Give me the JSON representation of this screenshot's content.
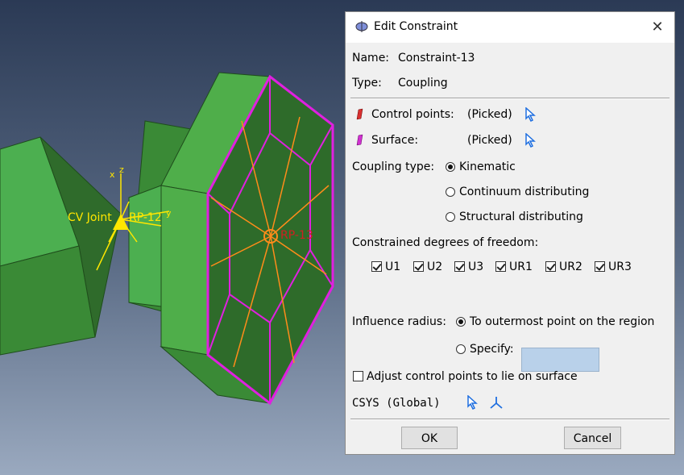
{
  "viewport": {
    "labels": {
      "cv_joint": "CV Joint",
      "rp12": "RP-12",
      "rp13": "RP-13",
      "axis_x": "x",
      "axis_z": "z",
      "axis_y": "y"
    },
    "colors": {
      "part_green": "#3f8f3a",
      "part_dark": "#2e6b2a",
      "surface_magenta": "#e020e0",
      "spoke_orange": "#ff8c1a",
      "marker_yellow": "#ffe600"
    }
  },
  "dialog": {
    "title": "Edit Constraint",
    "close_icon": "close-icon",
    "name_label": "Name:",
    "name_value": "Constraint-13",
    "type_label": "Type:",
    "type_value": "Coupling",
    "control_points_label": "Control points:",
    "control_points_value": "(Picked)",
    "surface_label": "Surface:",
    "surface_value": "(Picked)",
    "coupling_type_label": "Coupling type:",
    "coupling_options": [
      "Kinematic",
      "Continuum distributing",
      "Structural distributing"
    ],
    "coupling_selected": "Kinematic",
    "dof_label": "Constrained degrees of freedom:",
    "dof": [
      "U1",
      "U2",
      "U3",
      "UR1",
      "UR2",
      "UR3"
    ],
    "influence_label": "Influence radius:",
    "influence_option_outermost": "To outermost point on the region",
    "influence_option_specify": "Specify:",
    "specify_value": "",
    "adjust_label": "Adjust control points to lie on surface",
    "csys_label": "CSYS (Global)",
    "ok_label": "OK",
    "cancel_label": "Cancel"
  }
}
